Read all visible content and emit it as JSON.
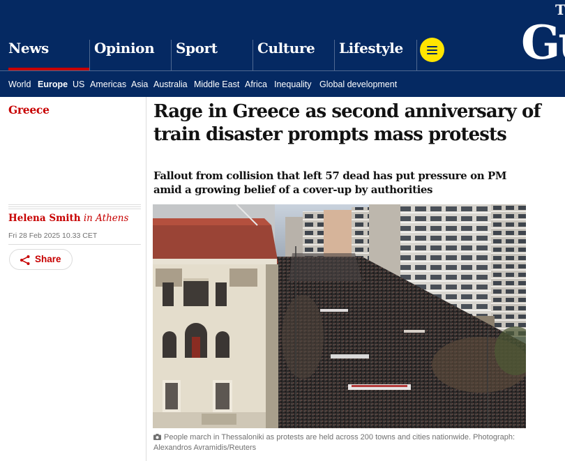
{
  "header": {
    "pillars": [
      {
        "label": "News",
        "active": true
      },
      {
        "label": "Opinion",
        "active": false
      },
      {
        "label": "Sport",
        "active": false
      },
      {
        "label": "Culture",
        "active": false
      },
      {
        "label": "Lifestyle",
        "active": false
      }
    ],
    "menu_icon": "menu-icon",
    "logo_text": "Gu",
    "logo_dot": "T",
    "colors": {
      "brand": "#052962",
      "accent": "#c70000",
      "menu": "#ffe500"
    }
  },
  "subnav": {
    "items": [
      {
        "label": "World",
        "bold": false
      },
      {
        "label": "Europe",
        "bold": true
      },
      {
        "label": "US",
        "bold": false
      },
      {
        "label": "Americas",
        "bold": false
      },
      {
        "label": "Asia",
        "bold": false
      },
      {
        "label": "Australia",
        "bold": false
      },
      {
        "label": "Middle East",
        "bold": false
      },
      {
        "label": "Africa",
        "bold": false
      },
      {
        "label": "Inequality",
        "bold": false
      },
      {
        "label": "Global development",
        "bold": false
      }
    ]
  },
  "article": {
    "section": "Greece",
    "headline": "Rage in Greece as second anniversary of train disaster prompts mass protests",
    "standfirst": "Fallout from collision that left 57 dead has put pressure on PM amid a growing belief of a cover-up by authorities",
    "byline": {
      "name": "Helena Smith",
      "location": "in Athens"
    },
    "date": "Fri 28 Feb 2025 10.33 CET",
    "share_label": "Share",
    "share_icon": "share-icon",
    "caption": "People march in Thessaloniki as protests are held across 200 towns and cities nationwide. Photograph: Alexandros Avramidis/Reuters",
    "caption_icon": "camera-icon"
  }
}
